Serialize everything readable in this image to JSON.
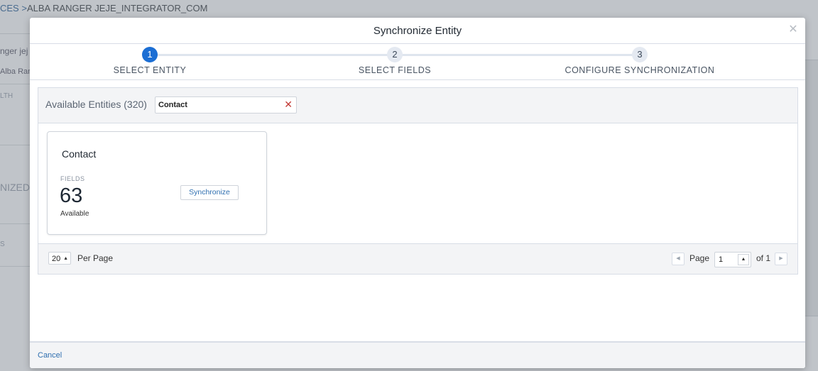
{
  "background": {
    "breadcrumb_link": "CES >",
    "breadcrumb_title": "ALBA RANGER JEJE_INTEGRATOR_COM",
    "side_texts": [
      "nger jej",
      "Alba Ran",
      "LTH",
      "NIZED",
      "S"
    ]
  },
  "modal": {
    "title": "Synchronize Entity",
    "close_icon": "close-icon"
  },
  "stepper": {
    "steps": [
      {
        "number": "1",
        "label": "SELECT ENTITY",
        "active": true
      },
      {
        "number": "2",
        "label": "SELECT FIELDS",
        "active": false
      },
      {
        "number": "3",
        "label": "CONFIGURE SYNCHRONIZATION",
        "active": false
      }
    ]
  },
  "entities": {
    "available_label": "Available Entities (320)",
    "search_value": "Contact",
    "clear_icon": "clear-icon",
    "cards": [
      {
        "title": "Contact",
        "fields_label": "FIELDS",
        "fields_count": "63",
        "available_label": "Available",
        "button_label": "Synchronize"
      }
    ]
  },
  "pagination": {
    "per_page_value": "20",
    "per_page_label": "Per Page",
    "page_label": "Page",
    "current_page": "1",
    "of_label": "of 1"
  },
  "footer": {
    "cancel_label": "Cancel"
  },
  "colors": {
    "accent": "#1b6ed4",
    "link": "#2f6fb0",
    "clear": "#c23934"
  }
}
